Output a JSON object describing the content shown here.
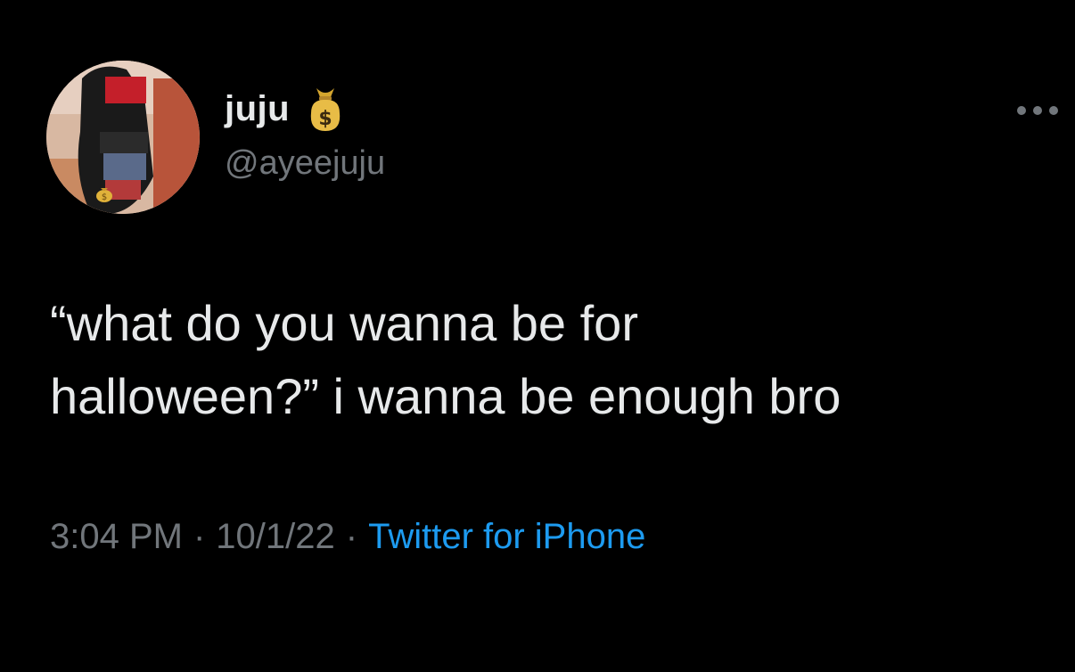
{
  "user": {
    "display_name": "juju",
    "name_emoji": "money-bag-emoji",
    "handle": "@ayeejuju",
    "avatar_icon": "profile-avatar",
    "avatar_badge": "money-bag-emoji"
  },
  "menu": {
    "icon": "more-options-icon"
  },
  "tweet": {
    "text": "“what do you wanna be for\nhalloween?” i wanna be enough bro"
  },
  "meta": {
    "time": "3:04 PM",
    "separator": "·",
    "date": "10/1/22",
    "source": "Twitter for iPhone"
  },
  "colors": {
    "background": "#000000",
    "text_primary": "#e7e9ea",
    "text_secondary": "#71767b",
    "link": "#1d9bf0",
    "money_bag": "#e0b23a"
  }
}
